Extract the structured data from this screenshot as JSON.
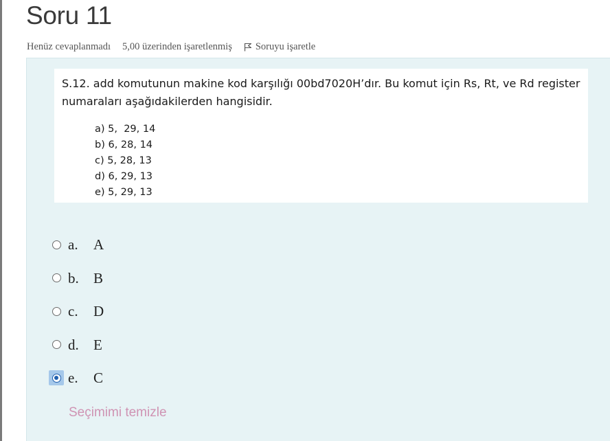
{
  "question": {
    "title": "Soru 11",
    "state": "Henüz cevaplanmadı",
    "grade": "5,00 üzerinden işaretlenmiş",
    "flag_label": "Soruyu işaretle"
  },
  "question_image": {
    "stem_line1": "S.12. add komutunun makine kod karşılığı 00bd7020H’dır. Bu komut için Rs, Rt, ve Rd register",
    "stem_line2": "numaraları aşağıdakilerden hangisidir.",
    "options": [
      "a) 5,  29, 14",
      "b) 6, 28, 14",
      "c) 5, 28, 13",
      "d) 6, 29, 13",
      "e) 5, 29, 13"
    ]
  },
  "answers": [
    {
      "letter": "a.",
      "text": "A",
      "selected": false
    },
    {
      "letter": "b.",
      "text": "B",
      "selected": false
    },
    {
      "letter": "c.",
      "text": "D",
      "selected": false
    },
    {
      "letter": "d.",
      "text": "E",
      "selected": false
    },
    {
      "letter": "e.",
      "text": "C",
      "selected": true
    }
  ],
  "clear_choice_label": "Seçimimi temizle",
  "colors": {
    "panel_bg": "#e7f3f5",
    "link": "#cf93b3",
    "radio_selected": "#1f5fae",
    "selected_highlight": "#a5c8ea"
  }
}
